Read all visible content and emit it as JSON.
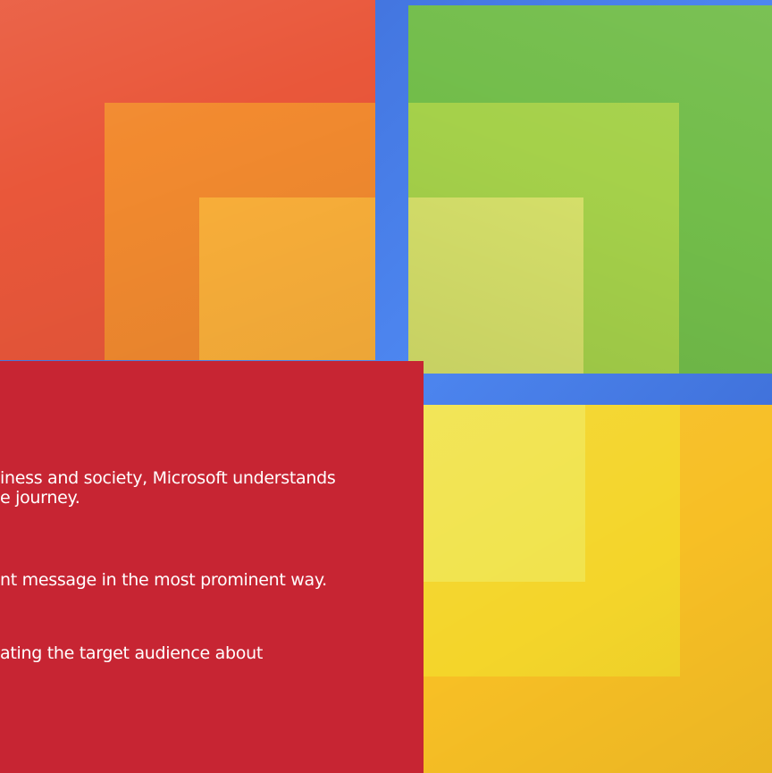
{
  "background": {
    "colors": {
      "frame_blue": "#3d6fd6",
      "tile_red": "#e9573a",
      "tile_orange": "#f28a2f",
      "tile_amber": "#fbb03a",
      "tile_green": "#72bd4a",
      "tile_lime": "#a5d14a",
      "tile_pale_green": "#d6e06a",
      "tile_yellow": "#f7bf25",
      "tile_light_yellow": "#f1e34c"
    }
  },
  "panel": {
    "color": "#c72533",
    "lines": [
      "iness and society, Microsoft understands",
      "e journey.",
      "nt message in the most prominent way.",
      "ating the target audience about",
      ""
    ]
  }
}
